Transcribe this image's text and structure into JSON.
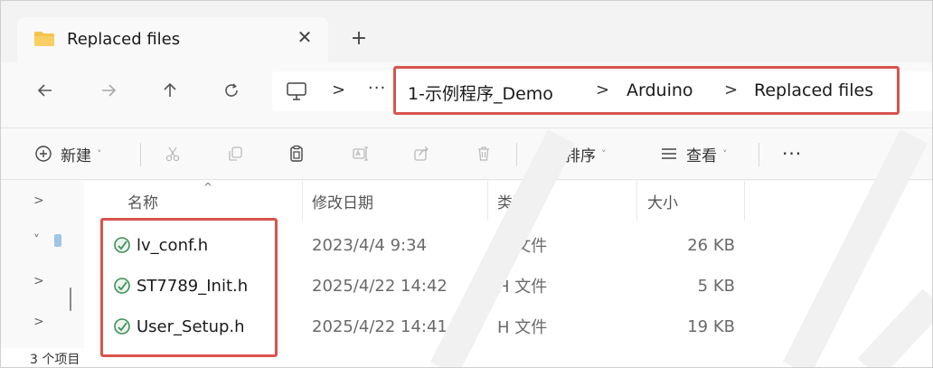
{
  "tab": {
    "title": "Replaced files",
    "close_glyph": "✕",
    "new_tab_glyph": "+"
  },
  "nav": {
    "back_icon": "arrow-left-icon",
    "forward_icon": "arrow-right-icon",
    "up_icon": "arrow-up-icon",
    "refresh_icon": "refresh-icon"
  },
  "address": {
    "more_glyph": "···",
    "separator": ">",
    "crumbs": [
      "1-示例程序_Demo",
      "Arduino",
      "Replaced files"
    ]
  },
  "toolbar": {
    "new_label": "新建",
    "sort_label": "排序",
    "view_label": "查看",
    "more_glyph": "···",
    "chevron": "˅"
  },
  "columns": {
    "name": "名称",
    "date": "修改日期",
    "type": "类型",
    "size": "大小",
    "sort_caret": "^"
  },
  "nav_pane": {
    "chevrons": [
      ">",
      "˅",
      ">",
      ">"
    ]
  },
  "files": [
    {
      "name": "lv_conf.h",
      "date": "2023/4/4 9:34",
      "type": "H 文件",
      "size": "26 KB"
    },
    {
      "name": "ST7789_Init.h",
      "date": "2025/4/22 14:42",
      "type": "H 文件",
      "size": "5 KB"
    },
    {
      "name": "User_Setup.h",
      "date": "2025/4/22 14:41",
      "type": "H 文件",
      "size": "19 KB"
    }
  ],
  "status": {
    "item_count": "3 个项目"
  },
  "colors": {
    "highlight": "#d9534f",
    "folder": "#f4c34d",
    "file_icon": "#3f8f5b"
  }
}
